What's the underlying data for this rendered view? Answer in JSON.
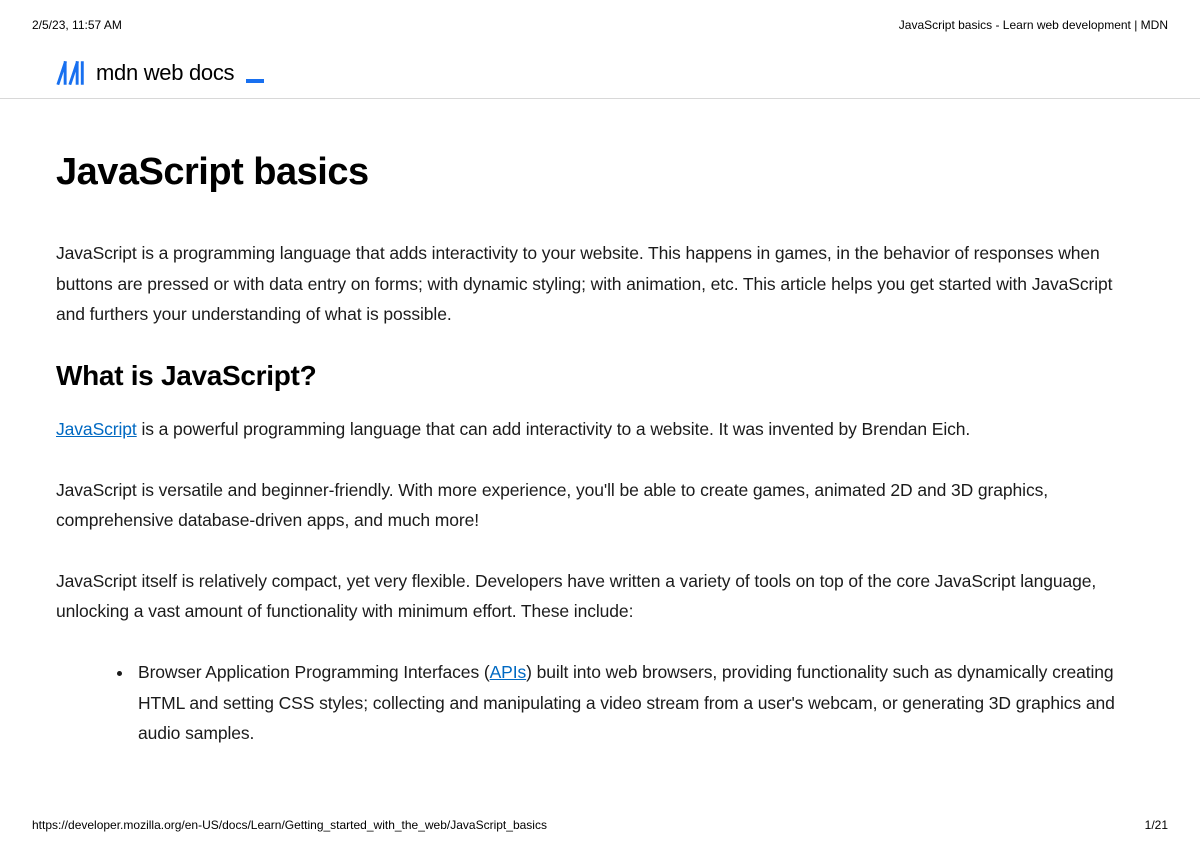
{
  "print": {
    "timestamp": "2/5/23, 11:57 AM",
    "doc_title": "JavaScript basics - Learn web development | MDN",
    "url": "https://developer.mozilla.org/en-US/docs/Learn/Getting_started_with_the_web/JavaScript_basics",
    "page_indicator": "1/21"
  },
  "brand": {
    "name": "mdn web docs"
  },
  "article": {
    "title": "JavaScript basics",
    "intro": "JavaScript is a programming language that adds interactivity to your website. This happens in games, in the behavior of responses when buttons are pressed or with data entry on forms; with dynamic styling; with animation, etc. This article helps you get started with JavaScript and furthers your understanding of what is possible.",
    "h2_what": "What is JavaScript?",
    "p1_link": "JavaScript",
    "p1_rest": " is a powerful programming language that can add interactivity to a website. It was invented by Brendan Eich.",
    "p2": "JavaScript is versatile and beginner-friendly. With more experience, you'll be able to create games, animated 2D and 3D graphics, comprehensive database-driven apps, and much more!",
    "p3": "JavaScript itself is relatively compact, yet very flexible. Developers have written a variety of tools on top of the core JavaScript language, unlocking a vast amount of functionality with minimum effort. These include:",
    "li1_pre": "Browser Application Programming Interfaces (",
    "li1_link": "APIs",
    "li1_post": ") built into web browsers, providing functionality such as dynamically creating HTML and setting CSS styles; collecting and manipulating a video stream from a user's webcam, or generating 3D graphics and audio samples."
  }
}
